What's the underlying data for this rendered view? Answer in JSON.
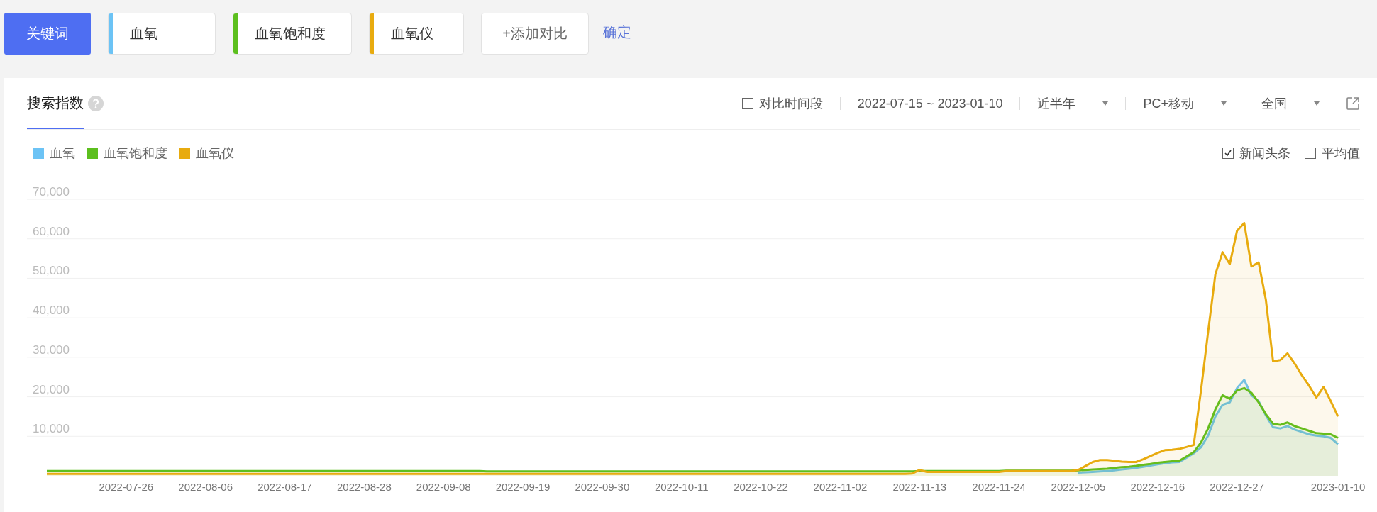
{
  "keyword_bar": {
    "label": "关键词",
    "keywords": [
      {
        "text": "血氧",
        "color": "#6cc3f5"
      },
      {
        "text": "血氧饱和度",
        "color": "#5cbf1e"
      },
      {
        "text": "血氧仪",
        "color": "#e8ab0f"
      }
    ],
    "add_button": "+添加对比",
    "confirm": "确定"
  },
  "panel": {
    "tabs": [
      {
        "label": "搜索指数",
        "selected": true
      }
    ],
    "compare_period": {
      "label": "对比时间段",
      "checked": false
    },
    "date_range": "2022-07-15 ~ 2023-01-10",
    "dropdowns": [
      "近半年",
      "PC+移动",
      "全国"
    ],
    "options": [
      {
        "label": "新闻头条",
        "checked": true
      },
      {
        "label": "平均值",
        "checked": false
      }
    ],
    "chart_data": {
      "type": "area",
      "grid": true,
      "categories": [
        null,
        null,
        null,
        null,
        null,
        null,
        null,
        null,
        null,
        null,
        null,
        "2022-07-26",
        null,
        null,
        null,
        null,
        null,
        null,
        null,
        null,
        null,
        null,
        "2022-08-06",
        null,
        null,
        null,
        null,
        null,
        null,
        null,
        null,
        null,
        null,
        "2022-08-17",
        null,
        null,
        null,
        null,
        null,
        null,
        null,
        null,
        null,
        null,
        "2022-08-28",
        null,
        null,
        null,
        null,
        null,
        null,
        null,
        null,
        null,
        null,
        "2022-09-08",
        null,
        null,
        null,
        null,
        null,
        null,
        null,
        null,
        null,
        null,
        "2022-09-19",
        null,
        null,
        null,
        null,
        null,
        null,
        null,
        null,
        null,
        null,
        "2022-09-30",
        null,
        null,
        null,
        null,
        null,
        null,
        null,
        null,
        null,
        null,
        "2022-10-11",
        null,
        null,
        null,
        null,
        null,
        null,
        null,
        null,
        null,
        null,
        "2022-10-22",
        null,
        null,
        null,
        null,
        null,
        null,
        null,
        null,
        null,
        null,
        "2022-11-02",
        null,
        null,
        null,
        null,
        null,
        null,
        null,
        null,
        null,
        null,
        "2022-11-13",
        null,
        null,
        null,
        null,
        null,
        null,
        null,
        null,
        null,
        null,
        "2022-11-24",
        null,
        null,
        null,
        null,
        null,
        null,
        null,
        null,
        null,
        null,
        "2022-12-05",
        null,
        null,
        null,
        null,
        null,
        null,
        null,
        null,
        null,
        null,
        "2022-12-16",
        null,
        null,
        null,
        null,
        null,
        null,
        null,
        null,
        null,
        null,
        "2022-12-27",
        null,
        null,
        null,
        null,
        null,
        null,
        null,
        null,
        null,
        null,
        null,
        null,
        null,
        "2023-01-10"
      ],
      "series": [
        {
          "name": "血氧",
          "color": "#6cc3f5",
          "values": [
            null,
            null,
            null,
            null,
            null,
            null,
            null,
            null,
            null,
            null,
            null,
            null,
            null,
            null,
            null,
            null,
            null,
            null,
            null,
            null,
            null,
            null,
            null,
            null,
            null,
            null,
            null,
            null,
            null,
            null,
            null,
            null,
            null,
            null,
            null,
            null,
            null,
            null,
            null,
            null,
            null,
            null,
            null,
            null,
            null,
            null,
            null,
            null,
            null,
            null,
            null,
            null,
            null,
            null,
            null,
            null,
            null,
            null,
            null,
            null,
            null,
            null,
            null,
            null,
            null,
            null,
            null,
            null,
            null,
            null,
            null,
            null,
            null,
            null,
            null,
            null,
            null,
            null,
            null,
            null,
            null,
            null,
            null,
            null,
            null,
            null,
            null,
            null,
            null,
            null,
            null,
            null,
            null,
            null,
            null,
            null,
            null,
            null,
            null,
            null,
            null,
            null,
            null,
            null,
            null,
            null,
            null,
            null,
            null,
            null,
            null,
            null,
            null,
            null,
            null,
            null,
            null,
            null,
            null,
            null,
            null,
            null,
            null,
            null,
            null,
            null,
            null,
            null,
            null,
            null,
            null,
            null,
            null,
            null,
            null,
            null,
            null,
            null,
            null,
            null,
            null,
            null,
            null,
            800,
            900,
            1000,
            1100,
            1200,
            1400,
            1600,
            1800,
            2000,
            2300,
            2600,
            2900,
            3200,
            3400,
            3500,
            4600,
            5700,
            7200,
            10200,
            15000,
            18000,
            18600,
            22200,
            24300,
            20400,
            18900,
            15300,
            12300,
            12000,
            12600,
            11700,
            11100,
            10500,
            10200,
            10000,
            9600,
            8000
          ]
        },
        {
          "name": "血氧饱和度",
          "color": "#5cbf1e",
          "values": [
            1200,
            1200,
            1200,
            1200,
            1200,
            1200,
            1200,
            1200,
            1200,
            1200,
            1200,
            1200,
            1200,
            1200,
            1200,
            1200,
            1200,
            1200,
            1200,
            1200,
            1200,
            1200,
            1200,
            1200,
            1200,
            1200,
            1200,
            1200,
            1200,
            1200,
            1200,
            1200,
            1200,
            1200,
            1200,
            1200,
            1200,
            1200,
            1200,
            1200,
            1200,
            1200,
            1200,
            1200,
            1200,
            1200,
            1200,
            1200,
            1200,
            1200,
            1200,
            1200,
            1200,
            1200,
            1200,
            1200,
            1200,
            1200,
            1200,
            1200,
            1200,
            1100,
            1100,
            1100,
            1100,
            1100,
            1100,
            1100,
            1100,
            1100,
            1100,
            1100,
            1100,
            1100,
            1100,
            1100,
            1100,
            1100,
            1100,
            1100,
            1100,
            1100,
            1100,
            1100,
            1100,
            1100,
            1100,
            1100,
            1100,
            1100,
            1100,
            1100,
            1100,
            1100,
            1100,
            1100,
            1100,
            1100,
            1100,
            1100,
            1100,
            1100,
            1100,
            1100,
            1100,
            1100,
            1100,
            1100,
            1100,
            1100,
            1100,
            1100,
            1100,
            1100,
            1100,
            1100,
            1100,
            1100,
            1100,
            1100,
            1100,
            1200,
            1200,
            1200,
            1200,
            1200,
            1200,
            1200,
            1200,
            1200,
            1200,
            1200,
            1200,
            1300,
            1300,
            1300,
            1300,
            1300,
            1300,
            1300,
            1300,
            1300,
            1300,
            1400,
            1500,
            1600,
            1700,
            1800,
            2000,
            2200,
            2300,
            2500,
            2800,
            3000,
            3300,
            3500,
            3700,
            3800,
            4900,
            6000,
            8400,
            12000,
            16800,
            20400,
            19500,
            21600,
            22200,
            21000,
            18600,
            15600,
            13200,
            12900,
            13500,
            12600,
            12000,
            11400,
            10800,
            10700,
            10500,
            9600
          ]
        },
        {
          "name": "血氧仪",
          "color": "#e8ab0f",
          "values": [
            500,
            500,
            500,
            500,
            500,
            500,
            500,
            500,
            500,
            500,
            500,
            500,
            500,
            500,
            500,
            500,
            500,
            500,
            500,
            500,
            500,
            500,
            500,
            500,
            500,
            500,
            500,
            500,
            500,
            500,
            500,
            500,
            500,
            500,
            500,
            500,
            500,
            500,
            500,
            500,
            500,
            500,
            500,
            500,
            500,
            500,
            500,
            500,
            500,
            500,
            500,
            500,
            500,
            500,
            500,
            500,
            500,
            500,
            500,
            500,
            500,
            500,
            500,
            500,
            500,
            500,
            500,
            500,
            500,
            500,
            500,
            500,
            500,
            500,
            500,
            500,
            500,
            500,
            500,
            500,
            500,
            500,
            500,
            500,
            500,
            500,
            500,
            500,
            500,
            500,
            500,
            500,
            500,
            500,
            500,
            500,
            500,
            500,
            500,
            500,
            500,
            500,
            500,
            500,
            500,
            500,
            500,
            500,
            500,
            500,
            500,
            500,
            500,
            500,
            500,
            500,
            500,
            500,
            500,
            500,
            600,
            1500,
            1000,
            1000,
            1000,
            1000,
            1000,
            1000,
            1000,
            1000,
            1000,
            1000,
            1000,
            1200,
            1200,
            1200,
            1200,
            1200,
            1200,
            1200,
            1200,
            1200,
            1200,
            1500,
            2500,
            3500,
            4000,
            4000,
            3800,
            3600,
            3500,
            3500,
            4200,
            5000,
            5800,
            6500,
            6600,
            6800,
            7300,
            7800,
            21500,
            36500,
            51000,
            56600,
            53600,
            62000,
            64000,
            53000,
            54000,
            44600,
            29000,
            29300,
            31000,
            28400,
            25400,
            22800,
            19800,
            22500,
            18900,
            15000
          ]
        }
      ],
      "ylim": [
        0,
        70000
      ],
      "yticks": [
        {
          "value": 10000,
          "label": "10,000"
        },
        {
          "value": 20000,
          "label": "20,000"
        },
        {
          "value": 30000,
          "label": "30,000"
        },
        {
          "value": 40000,
          "label": "40,000"
        },
        {
          "value": 50000,
          "label": "50,000"
        },
        {
          "value": 60000,
          "label": "60,000"
        },
        {
          "value": 70000,
          "label": "70,000"
        }
      ]
    }
  }
}
